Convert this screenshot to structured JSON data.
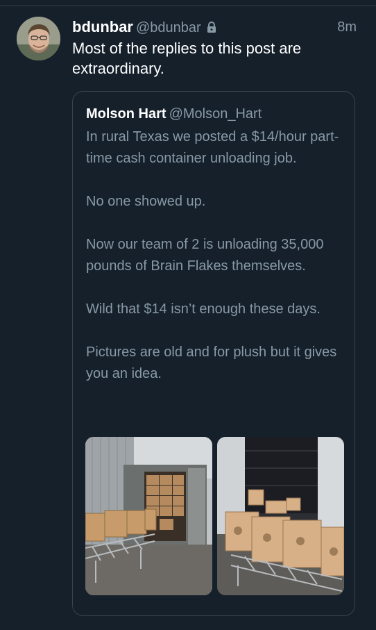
{
  "tweet": {
    "author_name": "bdunbar",
    "author_handle": "@bdunbar",
    "locked_icon": "lock-icon",
    "time": "8m",
    "text": "Most of the replies to this post are extraordinary."
  },
  "quoted_tweet": {
    "author_name": "Molson Hart",
    "author_handle": "@Molson_Hart",
    "paragraphs": [
      "In rural Texas we posted a $14/hour part-time cash container unloading job.",
      "No one showed up.",
      "Now our team of 2 is unloading 35,000 pounds of Brain Flakes themselves.",
      "Wild that $14 isn’t enough these days.",
      "Pictures are old and for plush but it gives you an idea."
    ],
    "media": [
      "photo-container-boxes",
      "photo-warehouse-boxes"
    ]
  },
  "colors": {
    "background": "#15202b",
    "border": "#38444d",
    "secondary_text": "#8899a6",
    "primary_text": "#ffffff"
  }
}
